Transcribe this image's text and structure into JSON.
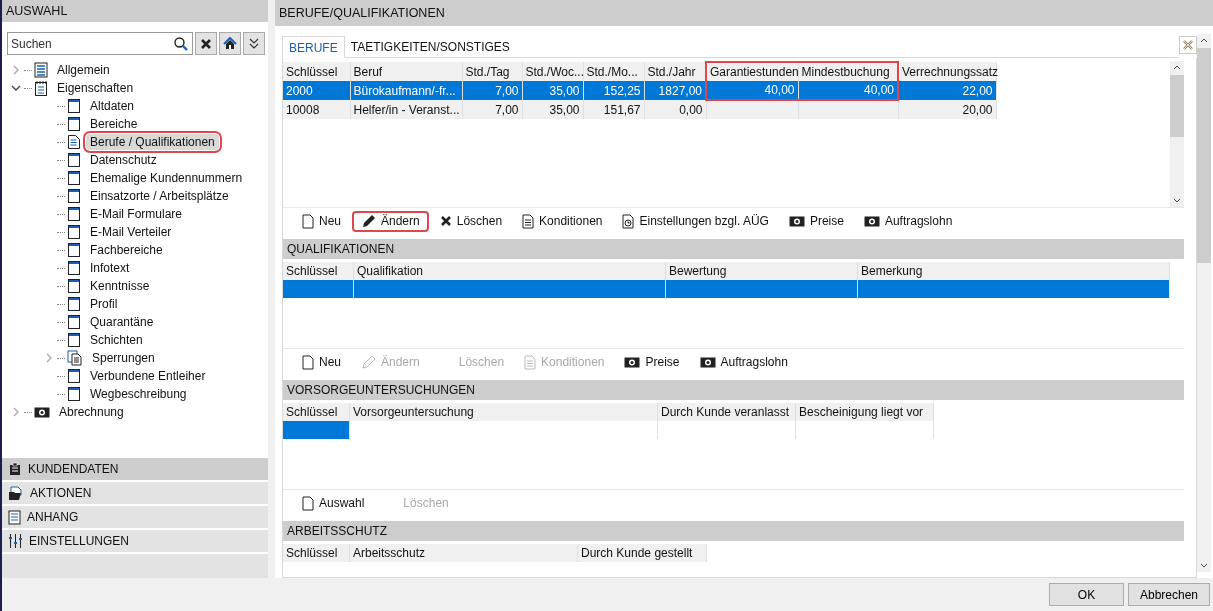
{
  "left_panel": {
    "title": "AUSWAHL",
    "search": {
      "placeholder": "Suchen"
    },
    "tree": [
      {
        "label": "Allgemein",
        "kind": "register",
        "expanded": false,
        "selected": false,
        "highlighted": false
      },
      {
        "label": "Eigenschaften",
        "kind": "notepad",
        "expanded": true,
        "selected": false,
        "highlighted": false,
        "children": [
          {
            "label": "Altdaten",
            "kind": "page",
            "selected": false,
            "highlighted": false
          },
          {
            "label": "Bereiche",
            "kind": "page",
            "selected": false,
            "highlighted": false
          },
          {
            "label": "Berufe / Qualifikationen",
            "kind": "document",
            "selected": true,
            "highlighted": true
          },
          {
            "label": "Datenschutz",
            "kind": "page",
            "selected": false,
            "highlighted": false
          },
          {
            "label": "Ehemalige Kundennummern",
            "kind": "page",
            "selected": false,
            "highlighted": false
          },
          {
            "label": "Einsatzorte / Arbeitsplätze",
            "kind": "page",
            "selected": false,
            "highlighted": false
          },
          {
            "label": "E-Mail Formulare",
            "kind": "page",
            "selected": false,
            "highlighted": false
          },
          {
            "label": "E-Mail Verteiler",
            "kind": "page",
            "selected": false,
            "highlighted": false
          },
          {
            "label": "Fachbereiche",
            "kind": "page",
            "selected": false,
            "highlighted": false
          },
          {
            "label": "Infotext",
            "kind": "page",
            "selected": false,
            "highlighted": false
          },
          {
            "label": "Kenntnisse",
            "kind": "page",
            "selected": false,
            "highlighted": false
          },
          {
            "label": "Profil",
            "kind": "page",
            "selected": false,
            "highlighted": false
          },
          {
            "label": "Quarantäne",
            "kind": "page",
            "selected": false,
            "highlighted": false
          },
          {
            "label": "Schichten",
            "kind": "page",
            "selected": false,
            "highlighted": false
          },
          {
            "label": "Sperrungen",
            "kind": "pages",
            "expanded": false,
            "selected": false,
            "highlighted": false
          },
          {
            "label": "Verbundene Entleiher",
            "kind": "page",
            "selected": false,
            "highlighted": false
          },
          {
            "label": "Wegbeschreibung",
            "kind": "page",
            "selected": false,
            "highlighted": false
          }
        ]
      },
      {
        "label": "Abrechnung",
        "kind": "money",
        "expanded": false,
        "selected": false,
        "highlighted": false
      }
    ],
    "sections": [
      {
        "label": "KUNDENDATEN",
        "kind": "clipboard",
        "selected": true
      },
      {
        "label": "AKTIONEN",
        "kind": "folder",
        "selected": false
      },
      {
        "label": "ANHANG",
        "kind": "list",
        "selected": false
      },
      {
        "label": "EINSTELLUNGEN",
        "kind": "sliders",
        "selected": false
      }
    ]
  },
  "right_panel": {
    "title": "BERUFE/QUALIFIKATIONEN",
    "tabs": [
      {
        "label": "BERUFE",
        "selected": true
      },
      {
        "label": "TAETIGKEITEN/SONSTIGES",
        "selected": false
      }
    ],
    "berufe_table": {
      "columns": [
        {
          "label": "Schlüssel",
          "highlighted": false
        },
        {
          "label": "Beruf",
          "highlighted": false
        },
        {
          "label": "Std./Tag",
          "highlighted": false
        },
        {
          "label": "Std./Woc...",
          "highlighted": false
        },
        {
          "label": "Std./Mo...",
          "highlighted": false
        },
        {
          "label": "Std./Jahr",
          "highlighted": false
        },
        {
          "label": "Garantiestunden",
          "highlighted": true
        },
        {
          "label": "Mindestbuchung",
          "highlighted": true
        },
        {
          "label": "Verrechnungssatz",
          "highlighted": false
        }
      ],
      "rows": [
        {
          "selected": true,
          "cells": [
            "2000",
            "Bürokaufmann/-fr...",
            "7,00",
            "35,00",
            "152,25",
            "1827,00",
            "40,00",
            "40,00",
            "22,00"
          ]
        },
        {
          "selected": false,
          "cells": [
            "10008",
            "Helfer/in - Veranst...",
            "7,00",
            "35,00",
            "151,67",
            "0,00",
            null,
            null,
            "20,00"
          ]
        }
      ]
    },
    "berufe_toolbar": [
      {
        "label": "Neu",
        "kind": "new",
        "disabled": false,
        "highlighted": false
      },
      {
        "label": "Ändern",
        "kind": "edit",
        "disabled": false,
        "highlighted": true
      },
      {
        "label": "Löschen",
        "kind": "delete",
        "disabled": false,
        "highlighted": false
      },
      {
        "label": "Konditionen",
        "kind": "doc",
        "disabled": false,
        "highlighted": false
      },
      {
        "label": "Einstellungen bzgl. AÜG",
        "kind": "settings",
        "disabled": false,
        "highlighted": false
      },
      {
        "label": "Preise",
        "kind": "money",
        "disabled": false,
        "highlighted": false
      },
      {
        "label": "Auftragslohn",
        "kind": "money",
        "disabled": false,
        "highlighted": false
      }
    ],
    "sections": [
      {
        "title": "QUALIFIKATIONEN",
        "table": {
          "columns": [
            {
              "label": "Schlüssel"
            },
            {
              "label": "Qualifikation"
            },
            {
              "label": "Bewertung"
            },
            {
              "label": "Bemerkung"
            }
          ],
          "rows": [
            {
              "cells_selected": [
                true,
                true,
                true,
                true
              ]
            }
          ]
        },
        "toolbar": [
          {
            "label": "Neu",
            "kind": "new",
            "disabled": false
          },
          {
            "label": "Ändern",
            "kind": "edit",
            "disabled": true
          },
          {
            "label": "Löschen",
            "kind": "plain",
            "disabled": true
          },
          {
            "label": "Konditionen",
            "kind": "doc",
            "disabled": true
          },
          {
            "label": "Preise",
            "kind": "money",
            "disabled": false
          },
          {
            "label": "Auftragslohn",
            "kind": "money",
            "disabled": false
          }
        ]
      },
      {
        "title": "VORSORGEUNTERSUCHUNGEN",
        "table": {
          "columns": [
            {
              "label": "Schlüssel"
            },
            {
              "label": "Vorsorgeuntersuchung"
            },
            {
              "label": "Durch Kunde veranlasst"
            },
            {
              "label": "Bescheinigung liegt vor"
            }
          ],
          "rows": [
            {
              "cells_selected": [
                true,
                false,
                false,
                false
              ]
            }
          ]
        },
        "toolbar": [
          {
            "label": "Auswahl",
            "kind": "new",
            "disabled": false
          },
          {
            "label": "Löschen",
            "kind": "plain",
            "disabled": true
          }
        ]
      },
      {
        "title": "ARBEITSSCHUTZ",
        "table": {
          "columns": [
            {
              "label": "Schlüssel"
            },
            {
              "label": "Arbeitsschutz"
            },
            {
              "label": "Durch Kunde gestellt"
            }
          ]
        }
      }
    ]
  },
  "footer": {
    "buttons": [
      "OK",
      "Abbrechen"
    ]
  }
}
